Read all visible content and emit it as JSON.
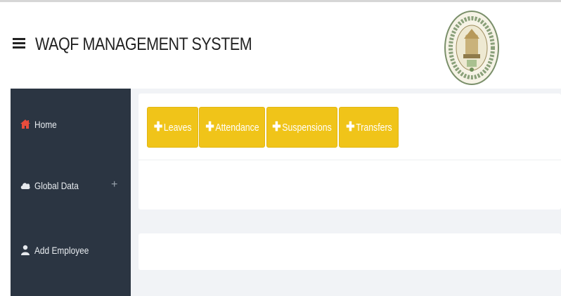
{
  "header": {
    "title": "WAQF MANAGEMENT SYSTEM",
    "menu_icon": "hamburger-menu-icon",
    "emblem": "state-waqf-board-emblem"
  },
  "sidebar": {
    "items": [
      {
        "label": "Home",
        "icon": "home-icon",
        "icon_color": "#e74c3c"
      },
      {
        "label": "Global Data",
        "icon": "cloud-icon",
        "expand": "+"
      },
      {
        "label": "Add Employee",
        "icon": "user-icon"
      }
    ]
  },
  "actions": {
    "buttons": [
      {
        "label": "Leaves",
        "icon": "plus-icon"
      },
      {
        "label": "Attendance",
        "icon": "plus-icon"
      },
      {
        "label": "Suspensions",
        "icon": "plus-icon"
      },
      {
        "label": "Transfers",
        "icon": "plus-icon"
      }
    ],
    "button_color": "#f0c419"
  },
  "theme": {
    "sidebar_bg": "#2b3542",
    "content_bg": "#f1f3f6"
  }
}
